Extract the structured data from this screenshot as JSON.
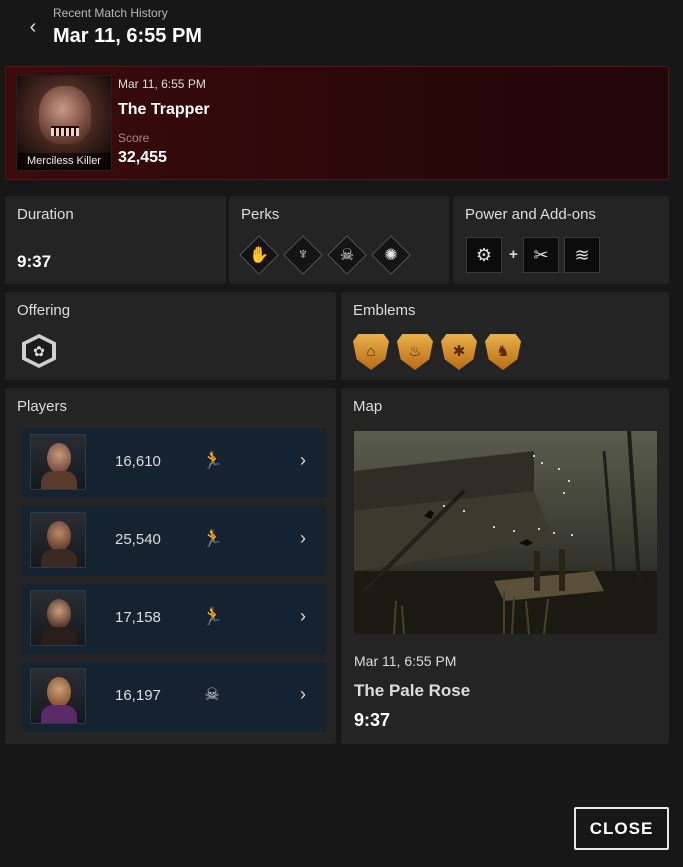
{
  "header": {
    "breadcrumb": "Recent Match History",
    "title": "Mar 11, 6:55 PM"
  },
  "summary": {
    "portrait_caption": "Merciless Killer",
    "date": "Mar 11, 6:55 PM",
    "character": "The Trapper",
    "score_label": "Score",
    "score": "32,455"
  },
  "duration": {
    "label": "Duration",
    "value": "9:37"
  },
  "perks": {
    "label": "Perks",
    "icons": [
      "perk-1-icon",
      "perk-2-icon",
      "perk-3-icon",
      "perk-4-icon"
    ]
  },
  "power": {
    "label": "Power and Add-ons",
    "plus": "+",
    "icons": [
      "bear-trap-icon",
      "pliers-addon-icon",
      "cloth-addon-icon"
    ]
  },
  "offering": {
    "label": "Offering",
    "icon": "offering-icon"
  },
  "emblems": {
    "label": "Emblems",
    "icons": [
      "gatekeeper-emblem-icon",
      "devout-emblem-icon",
      "malicious-emblem-icon",
      "chaser-emblem-icon"
    ],
    "color": "#d08a2a"
  },
  "players": {
    "label": "Players",
    "rows": [
      {
        "score": "16,610",
        "status": "escaped"
      },
      {
        "score": "25,540",
        "status": "escaped"
      },
      {
        "score": "17,158",
        "status": "escaped"
      },
      {
        "score": "16,197",
        "status": "killed"
      }
    ]
  },
  "map": {
    "label": "Map",
    "date": "Mar 11, 6:55 PM",
    "name": "The Pale Rose",
    "duration": "9:37"
  },
  "close_label": "CLOSE",
  "colors": {
    "summary_bg": "#3c0b0e",
    "player_row_bg": "#152230",
    "card_bg": "#242424"
  }
}
